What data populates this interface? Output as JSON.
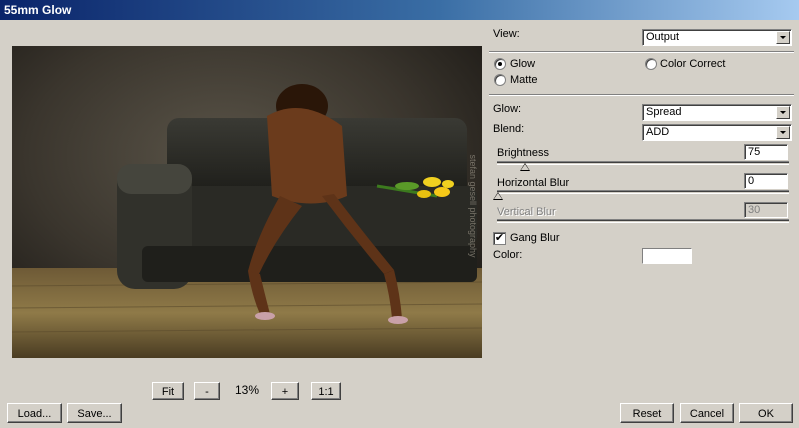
{
  "window": {
    "title": "55mm Glow"
  },
  "view": {
    "label": "View:",
    "value": "Output"
  },
  "mode": {
    "glow_label": "Glow",
    "matte_label": "Matte",
    "color_correct_label": "Color Correct",
    "selected": "Glow"
  },
  "glow": {
    "label": "Glow:",
    "value": "Spread"
  },
  "blend": {
    "label": "Blend:",
    "value": "ADD"
  },
  "brightness": {
    "label": "Brightness",
    "value": "75"
  },
  "horizontal_blur": {
    "label": "Horizontal Blur",
    "value": "0"
  },
  "vertical_blur": {
    "label": "Vertical Blur",
    "value": "30"
  },
  "gang_blur": {
    "label": "Gang Blur",
    "checked": true,
    "check_glyph": "✔"
  },
  "color": {
    "label": "Color:",
    "value_hex": "#ffffff"
  },
  "preview": {
    "watermark": "stefan gesell photography"
  },
  "zoom_bar": {
    "fit_label": "Fit",
    "minus_label": "-",
    "zoom_value": "13%",
    "plus_label": "+",
    "one_to_one_label": "1:1"
  },
  "footer": {
    "load_label": "Load...",
    "save_label": "Save...",
    "reset_label": "Reset",
    "cancel_label": "Cancel",
    "ok_label": "OK"
  }
}
